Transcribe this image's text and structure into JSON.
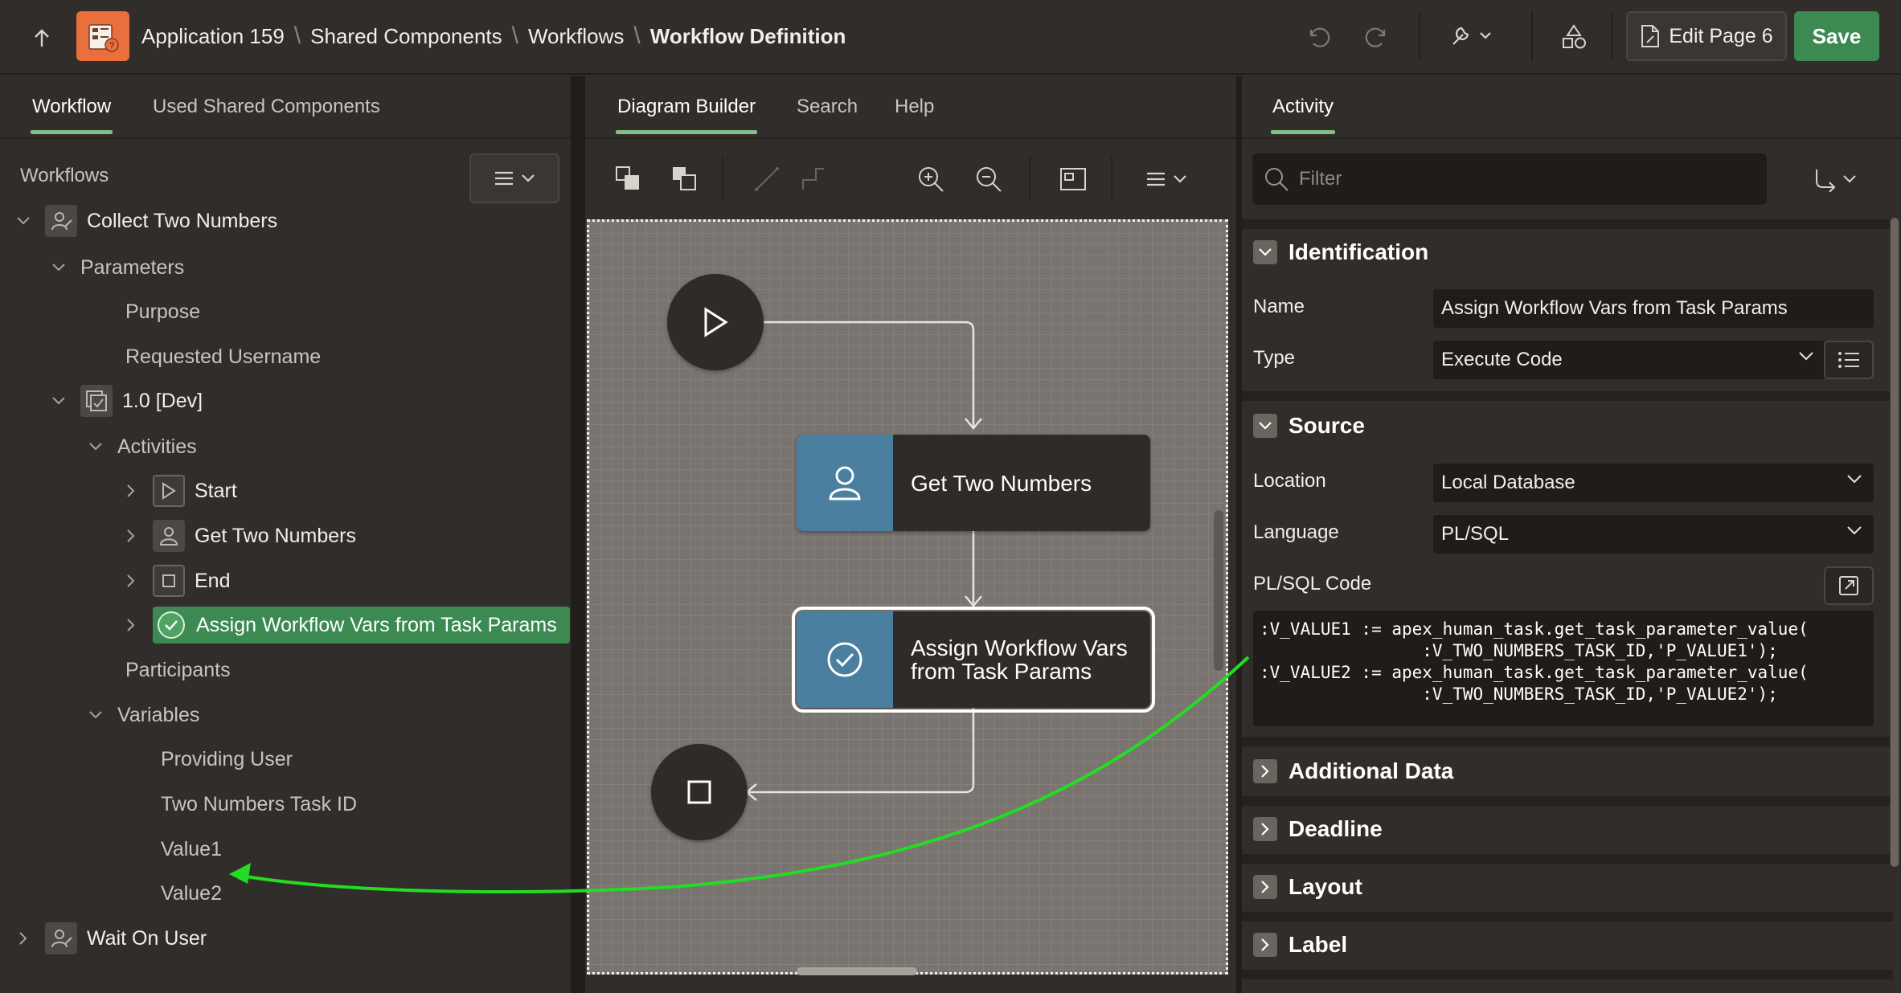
{
  "header": {
    "breadcrumbs": [
      "Application 159",
      "Shared Components",
      "Workflows"
    ],
    "current": "Workflow Definition",
    "edit_page": "Edit Page 6",
    "save": "Save"
  },
  "left": {
    "tabs": [
      "Workflow",
      "Used Shared Components"
    ],
    "tree_title": "Workflows",
    "tree": {
      "workflow": "Collect Two Numbers",
      "parameters": "Parameters",
      "param_items": [
        "Purpose",
        "Requested Username"
      ],
      "version": "1.0 [Dev]",
      "activities": "Activities",
      "activity_items": [
        "Start",
        "Get Two Numbers",
        "End"
      ],
      "selected_activity": "Assign Workflow Vars from Task Params",
      "participants": "Participants",
      "variables": "Variables",
      "variable_items": [
        "Providing User",
        "Two Numbers Task ID",
        "Value1",
        "Value2"
      ],
      "second_workflow": "Wait On User"
    }
  },
  "middle": {
    "tabs": [
      "Diagram Builder",
      "Search",
      "Help"
    ],
    "nodes": {
      "task1": "Get Two Numbers",
      "task2_line1": "Assign Workflow Vars",
      "task2_line2": "from Task Params"
    }
  },
  "right": {
    "tab": "Activity",
    "filter_placeholder": "Filter",
    "sections": {
      "identification": "Identification",
      "source": "Source",
      "additional_data": "Additional Data",
      "deadline": "Deadline",
      "layout": "Layout",
      "label": "Label"
    },
    "props": {
      "name_label": "Name",
      "name_value": "Assign Workflow Vars from Task Params",
      "type_label": "Type",
      "type_value": "Execute Code",
      "location_label": "Location",
      "location_value": "Local Database",
      "language_label": "Language",
      "language_value": "PL/SQL",
      "code_label": "PL/SQL Code"
    },
    "code": ":V_VALUE1 := apex_human_task.get_task_parameter_value(\n                :V_TWO_NUMBERS_TASK_ID,'P_VALUE1');\n:V_VALUE2 := apex_human_task.get_task_parameter_value(\n                :V_TWO_NUMBERS_TASK_ID,'P_VALUE2');"
  },
  "colors": {
    "accent_green": "#3c8a52",
    "annotation_arrow": "#22dd22",
    "task_icon_blue": "#4a7fa0",
    "app_logo": "#e96f3c"
  },
  "icons": [
    "up-arrow-icon",
    "app-logo-icon",
    "undo-icon",
    "redo-icon",
    "wrench-icon",
    "shapes-icon",
    "page-icon",
    "menu-icon",
    "chevron-down-icon",
    "chevron-right-icon",
    "workflow-icon",
    "version-icon",
    "play-icon",
    "user-icon",
    "stop-icon",
    "check-circle-icon",
    "zoom-in-icon",
    "zoom-out-icon",
    "search-icon",
    "list-icon",
    "expand-icon"
  ]
}
